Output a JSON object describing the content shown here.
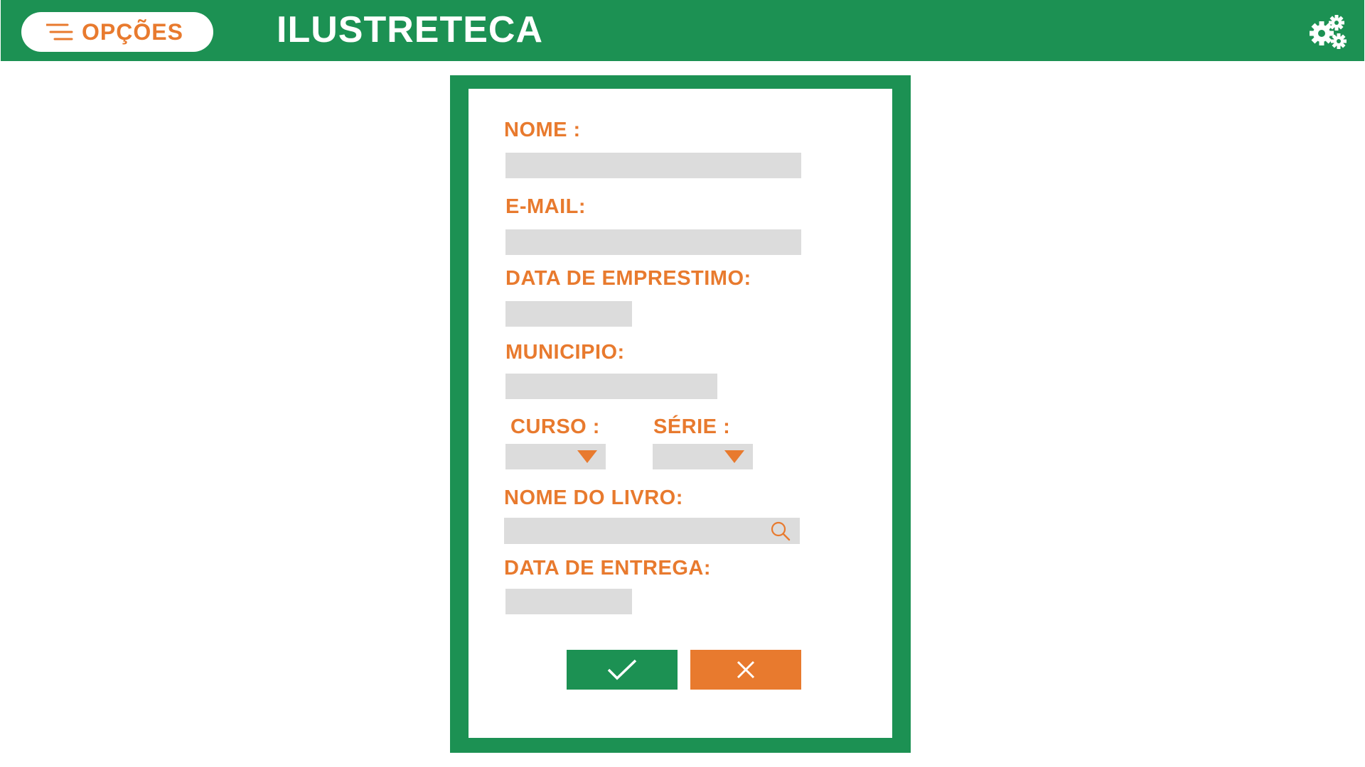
{
  "header": {
    "menu_label": "OPÇÕES",
    "menu_icon": "menu-lines-icon",
    "title": "ILUSTRETECA",
    "settings_icon": "gears-icon"
  },
  "form": {
    "nome": {
      "label": "NOME :",
      "value": "",
      "placeholder": ""
    },
    "email": {
      "label": "E-MAIL:",
      "value": "",
      "placeholder": ""
    },
    "data_emprestimo": {
      "label": "DATA DE EMPRESTIMO:",
      "value": "",
      "placeholder": ""
    },
    "municipio": {
      "label": "MUNICIPIO:",
      "value": "",
      "placeholder": ""
    },
    "curso": {
      "label": "CURSO :",
      "selected": ""
    },
    "serie": {
      "label": "SÉRIE :",
      "selected": ""
    },
    "nome_livro": {
      "label": "NOME DO LIVRO:",
      "value": "",
      "placeholder": ""
    },
    "data_entrega": {
      "label": "DATA DE ENTREGA:",
      "value": "",
      "placeholder": ""
    },
    "confirm_icon": "checkmark-icon",
    "cancel_icon": "close-icon"
  },
  "colors": {
    "brand_green": "#1c9153",
    "accent_orange": "#e87a2e",
    "field_gray": "#dcdcdc"
  }
}
